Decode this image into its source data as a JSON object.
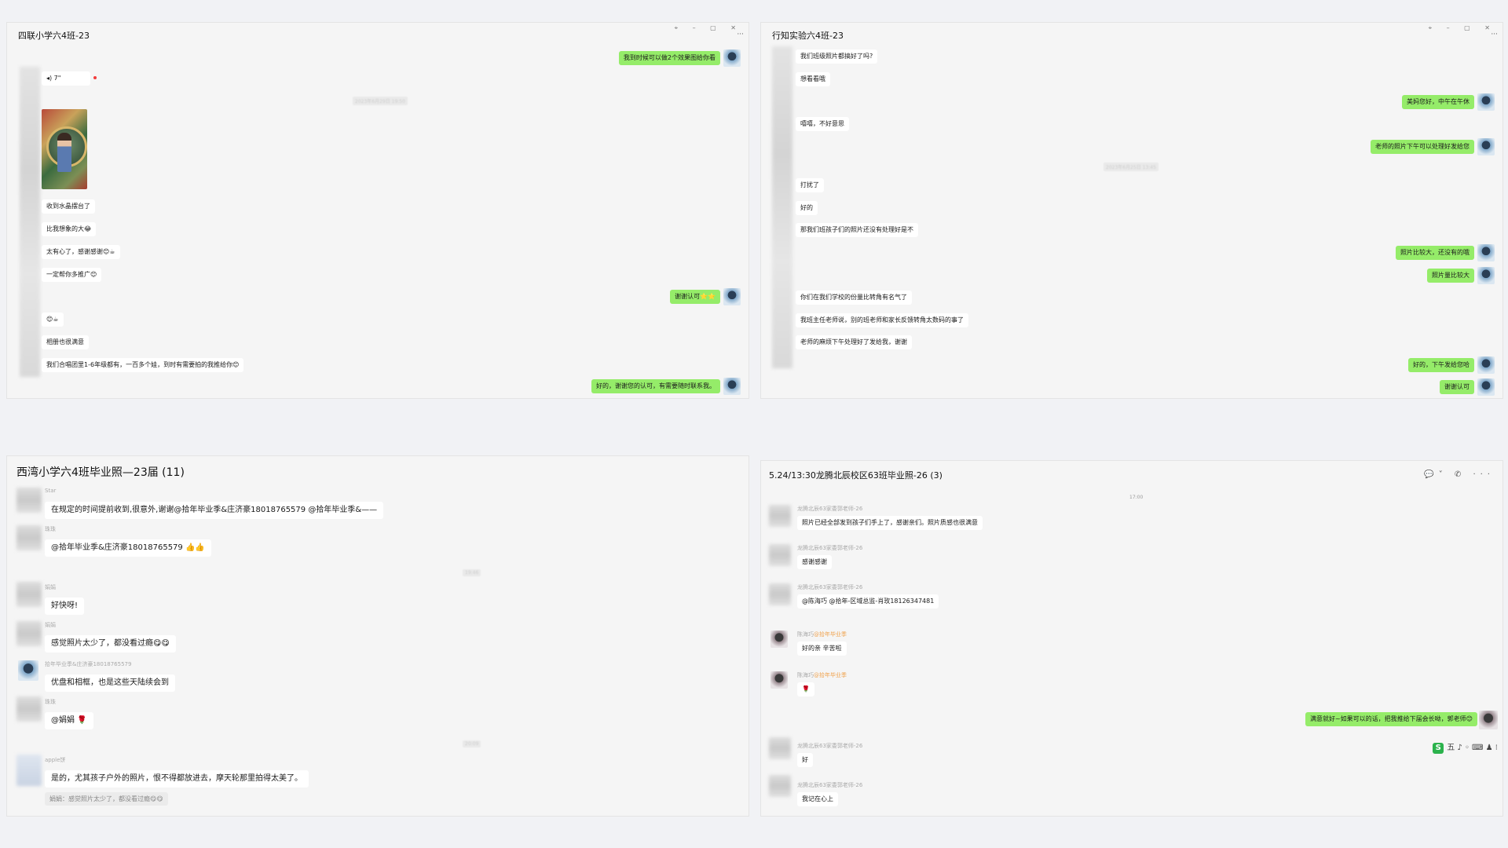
{
  "windows": [
    {
      "title": "四联小学六4班-23",
      "controls": "⌖ – ▢ ✕",
      "more": "···",
      "voice": "◂) 7\"",
      "timestamp": "2023年6月29日 19:50",
      "messages": [
        {
          "text": "我到时候可以做2个效果图给你看",
          "mine": true
        },
        {
          "text": "收到水晶摆台了",
          "mine": false
        },
        {
          "text": "比我想象的大😂",
          "mine": false
        },
        {
          "text": "太有心了，感谢感谢😊☕",
          "mine": false
        },
        {
          "text": "一定帮你多推广😊",
          "mine": false
        },
        {
          "text": "谢谢认可⭐⭐",
          "mine": true
        },
        {
          "text": "😊☕",
          "mine": false
        },
        {
          "text": "相册也很满意",
          "mine": false
        },
        {
          "text": "我们合唱团里1-6年级都有，一百多个娃，到时有需要拍的我推给你😊",
          "mine": false
        },
        {
          "text": "好的，谢谢您的认可，有需要随时联系我。",
          "mine": true
        }
      ]
    },
    {
      "title": "行知实验六4班-23",
      "controls": "⌖ – ▢ ✕",
      "more": "···",
      "timestamp": "2023年6月25日 13:45",
      "messages": [
        {
          "text": "我们班级照片都搞好了吗?",
          "mine": false
        },
        {
          "text": "想看看哦",
          "mine": false
        },
        {
          "text": "美妈您好，中午在午休",
          "mine": true
        },
        {
          "text": "嘻嘻，不好意思",
          "mine": false
        },
        {
          "text": "老师的照片下午可以处理好发给您",
          "mine": true
        },
        {
          "text": "打扰了",
          "mine": false
        },
        {
          "text": "好的",
          "mine": false
        },
        {
          "text": "那我们班孩子们的照片还没有处理好是不",
          "mine": false
        },
        {
          "text": "照片比较大，还没有的哦",
          "mine": true
        },
        {
          "text": "照片量比较大",
          "mine": true
        },
        {
          "text": "你们在我们学校的份量比转角有名气了",
          "mine": false
        },
        {
          "text": "我班主任老师说，别的班老师和家长反馈转角太数码的事了",
          "mine": false
        },
        {
          "text": "老师的麻烦下午处理好了发给我，谢谢",
          "mine": false
        },
        {
          "text": "好的，下午发给您哈",
          "mine": true
        },
        {
          "text": "谢谢认可",
          "mine": true
        }
      ]
    },
    {
      "title": "西湾小学六4班毕业照—23届 (11)",
      "times": [
        "19:46",
        "20:09"
      ],
      "messages": [
        {
          "nick": "Star",
          "text": "在规定的时间提前收到,很意外,谢谢@拾年毕业季&庄济豪18018765579 @拾年毕业季&——"
        },
        {
          "nick": "珠珠",
          "text": "@拾年毕业季&庄济豪18018765579 👍👍"
        },
        {
          "nick": "娟娟",
          "text": "好快呀!"
        },
        {
          "nick": "娟娟",
          "text": "感觉照片太少了，都没看过瘾😋😋"
        },
        {
          "nick": "拾年毕业季&庄济豪18018765579",
          "text": "优盘和相框，也是这些天陆续会到"
        },
        {
          "nick": "珠珠",
          "text": "@娟娟 🌹"
        },
        {
          "nick": "apple饼",
          "text": "是的，尤其孩子户外的照片，恨不得都放进去，摩天轮那里拍得太美了。"
        }
      ],
      "quote": "娟娟：感觉照片太少了，都没看过瘾😋😋"
    },
    {
      "title": "5.24/13:30龙腾北辰校区63班毕业照-26 (3)",
      "header_icons": "💬˅ ✆ ···",
      "time": "17:00",
      "messages": [
        {
          "nick": "龙腾北辰63家委郭老师-26",
          "text": "照片已经全部发到孩子们手上了，感谢亲们。照片质感也很满意",
          "mine": false
        },
        {
          "nick": "龙腾北辰63家委郭老师-26",
          "text": "感谢感谢",
          "mine": false
        },
        {
          "nick": "龙腾北辰63家委郭老师-26",
          "text": "@陈海巧 @拾年-区域总监-肖玫18126347481",
          "mine": false
        },
        {
          "nick": "陈海巧",
          "nick_hl": "@拾年毕业季",
          "text": "好的亲  辛苦啦",
          "mine": false
        },
        {
          "nick": "陈海巧",
          "nick_hl": "@拾年毕业季",
          "text": "🌹",
          "mine": false
        },
        {
          "text": "满意就好~如果可以的话，把我推给下届会长呦，郭老师😊",
          "mine": true
        },
        {
          "nick": "龙腾北辰63家委郭老师-26",
          "text": "好",
          "mine": false
        },
        {
          "nick": "龙腾北辰63家委郭老师-26",
          "text": "我记在心上",
          "mine": false
        }
      ],
      "ime_bar": "五 ♪ ◦ ⌨ ♟ ⁝"
    }
  ],
  "colors": {
    "mine_bubble": "#95ec69",
    "other_bubble": "#ffffff",
    "window_bg": "#f5f5f5"
  }
}
